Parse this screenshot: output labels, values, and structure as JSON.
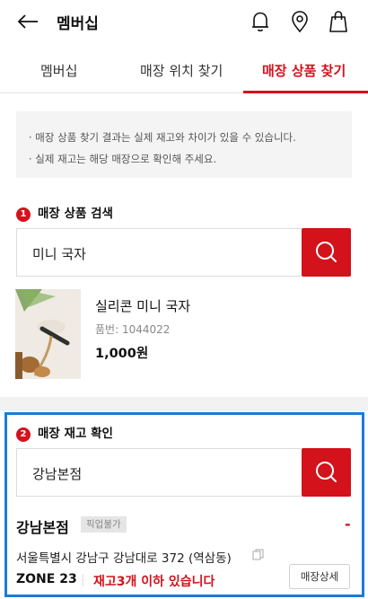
{
  "header": {
    "title": "멤버십",
    "back_icon": "arrow-left-icon",
    "icons": [
      "bell-icon",
      "location-pin-icon",
      "shopping-bag-icon"
    ]
  },
  "tabs": [
    {
      "label": "멤버십",
      "active": false
    },
    {
      "label": "매장 위치 찾기",
      "active": false
    },
    {
      "label": "매장 상품 찾기",
      "active": true
    }
  ],
  "notice": {
    "lines": [
      "· 매장 상품 찾기 결과는 실제 재고와 차이가 있을 수 있습니다.",
      "· 실제 재고는 해당 매장으로 확인해 주세요."
    ]
  },
  "product_search": {
    "step": "1",
    "title": "매장 상품 검색",
    "query": "미니 국자",
    "result": {
      "name": "실리콘 미니 국자",
      "code": "품번: 1044022",
      "price": "1,000원"
    }
  },
  "stock_check": {
    "step": "2",
    "title": "매장 재고 확인",
    "query": "강남본점",
    "store": {
      "name": "강남본점",
      "pickup_tag": "픽업불가",
      "status_mark": "-",
      "address": "서울특별시 강남구 강남대로 372 (역삼동)",
      "zone": "ZONE 23",
      "stock_status": "재고3개 이하 있습니다",
      "detail_button": "매장상세"
    }
  },
  "colors": {
    "accent": "#d3121b",
    "highlight_border": "#1e7bd6",
    "notice_bg": "#f4f4f4"
  }
}
